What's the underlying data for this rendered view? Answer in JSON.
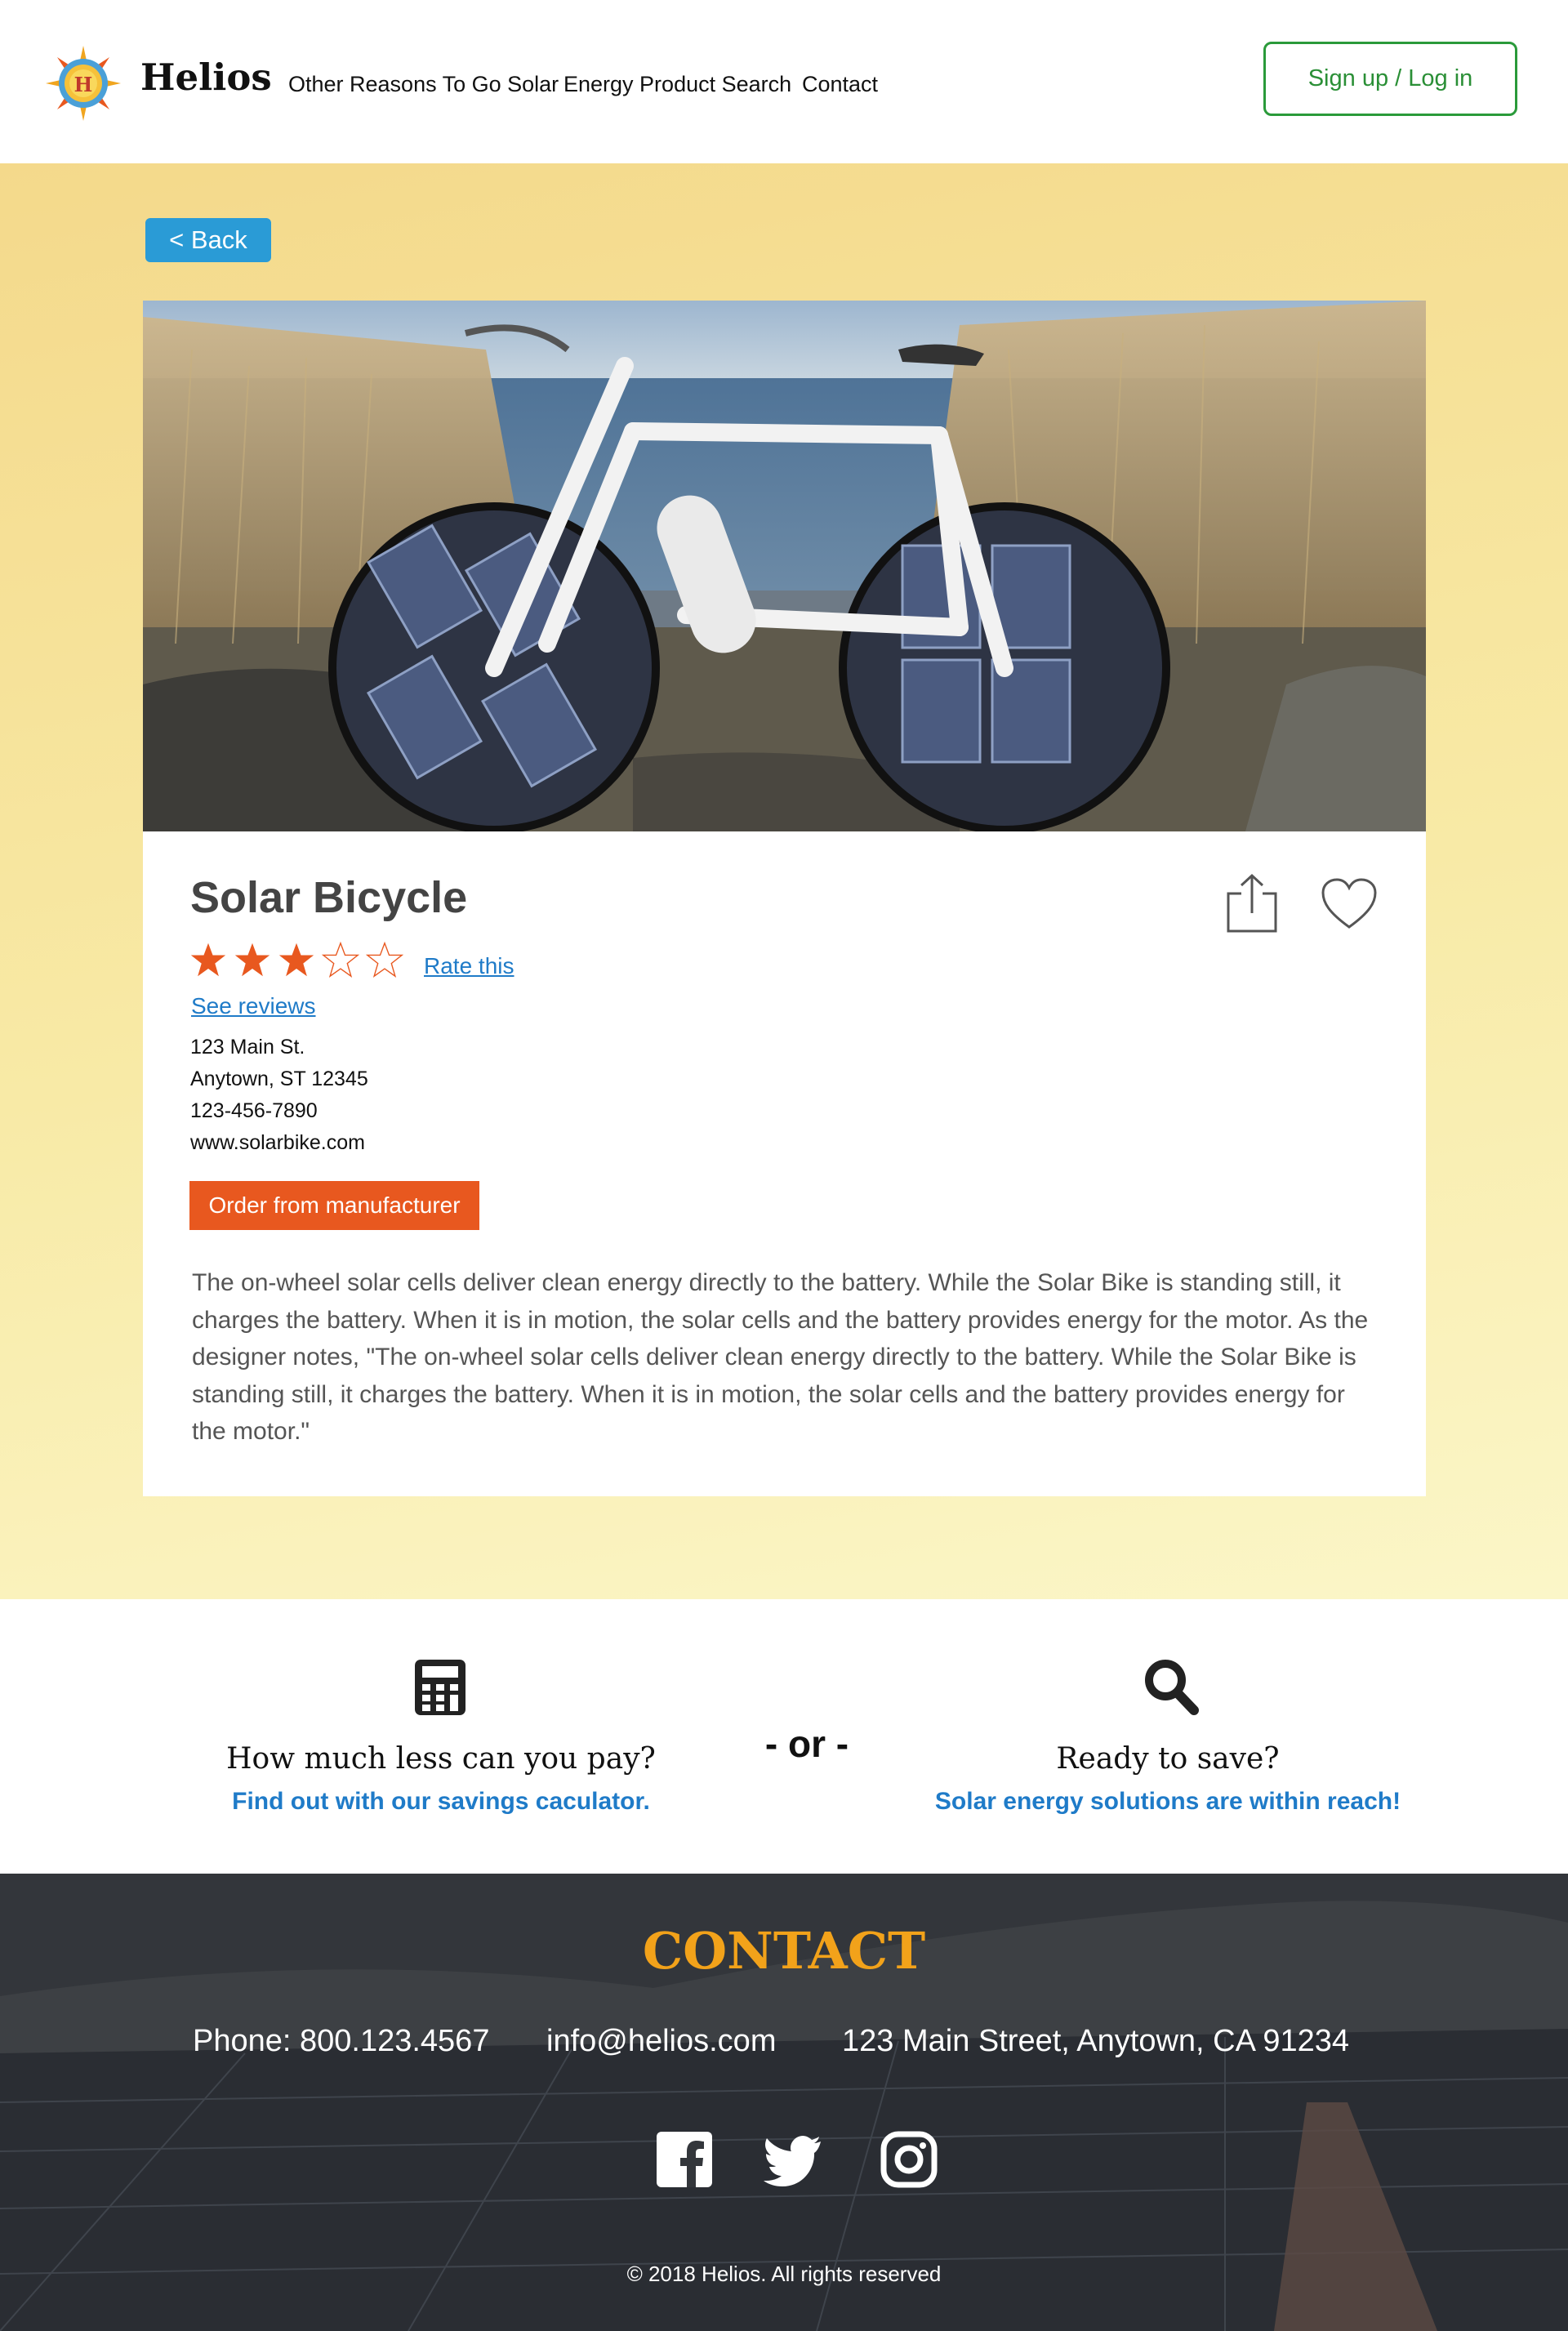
{
  "header": {
    "brand": "Helios",
    "nav": [
      "Other Reasons To Go Solar",
      "Energy Product Search",
      "Contact"
    ],
    "signup_label": "Sign up / Log in",
    "logo_letter": "H"
  },
  "product": {
    "back_label": "< Back",
    "title": "Solar Bicycle",
    "rating": 3,
    "rating_max": 5,
    "rate_label": "Rate this",
    "reviews_label": "See reviews",
    "address_line1": "123 Main St.",
    "address_line2": "Anytown, ST 12345",
    "phone": "123-456-7890",
    "website": "www.solarbike.com",
    "order_label": "Order from manufacturer",
    "description": "The on-wheel solar cells deliver clean energy directly to the battery. While the Solar Bike is standing still, it charges the battery. When it is in motion, the solar cells and the battery provides energy for the motor. As the designer notes, \"The on-wheel solar cells deliver clean energy directly to the battery. While the Solar Bike is standing still, it charges the battery. When it is in motion, the solar cells and the battery provides energy for the motor.\""
  },
  "promo": {
    "left_heading": "How much less can you pay?",
    "left_link": "Find out with our savings caculator.",
    "or_label": "- or -",
    "right_heading": "Ready to save?",
    "right_link": "Solar energy solutions are within reach!"
  },
  "footer": {
    "contact_title": "CONTACT",
    "phone": "Phone: 800.123.4567",
    "email": "info@helios.com",
    "address": "123 Main Street, Anytown, CA 91234",
    "copyright": "© 2018 Helios. All rights reserved"
  },
  "colors": {
    "accent_orange": "#e8581f",
    "link_blue": "#1f7bc8",
    "back_blue": "#2a9bd6",
    "signup_green": "#2a9a3a",
    "contact_gold": "#f2a21a"
  },
  "icons": [
    "sun-logo-icon",
    "share-icon",
    "heart-icon",
    "star-icon",
    "calculator-icon",
    "search-icon",
    "facebook-icon",
    "twitter-icon",
    "instagram-icon"
  ]
}
